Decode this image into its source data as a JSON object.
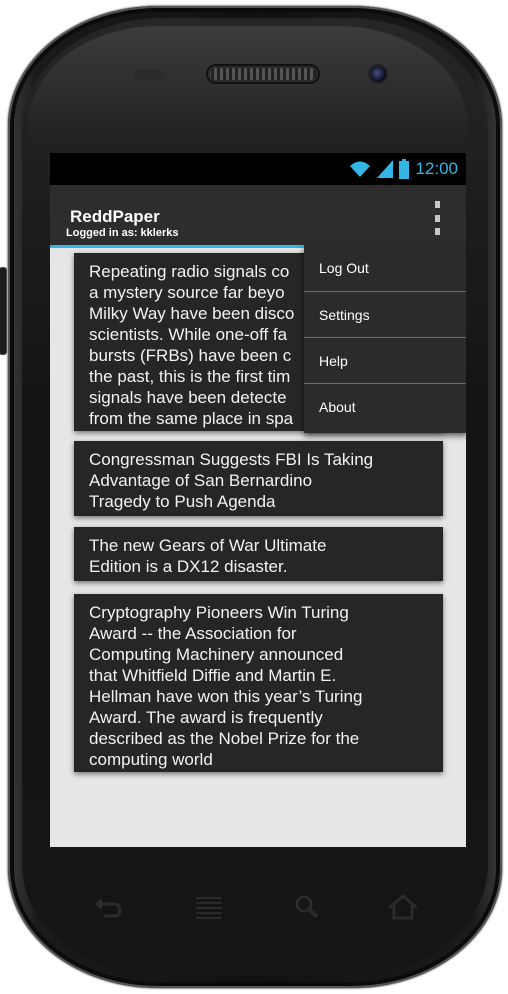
{
  "status_bar": {
    "time": "12:00",
    "icons": [
      "wifi-icon",
      "signal-icon",
      "battery-icon"
    ],
    "accent_color": "#33b5e5"
  },
  "action_bar": {
    "title": "ReddPaper",
    "subtitle": "Logged in as: kklerks",
    "overflow_icon": "more-vertical-icon"
  },
  "overflow_menu": {
    "items": [
      {
        "label": "Log Out"
      },
      {
        "label": "Settings"
      },
      {
        "label": "Help"
      },
      {
        "label": "About"
      }
    ]
  },
  "posts": [
    {
      "text": "Repeating radio signals co\na mystery source far beyo\nMilky Way have been disco\nscientists. While one-off fa\nbursts (FRBs) have been c\nthe past, this is the first tim\nsignals have been detecte\nfrom the same place in spa"
    },
    {
      "text": "Congressman Suggests FBI Is Taking\nAdvantage of San Bernardino\nTragedy to Push Agenda"
    },
    {
      "text": "The new Gears of War Ultimate\nEdition is a DX12 disaster."
    },
    {
      "text": "Cryptography Pioneers Win Turing\nAward -- the Association for\nComputing Machinery announced\nthat Whitfield Diffie and Martin E.\nHellman have won this year’s Turing\nAward. The award is frequently\ndescribed as the Nobel Prize for the\ncomputing world"
    }
  ],
  "nav_bar": {
    "icons": [
      "back-icon",
      "menu-icon",
      "search-icon",
      "home-icon"
    ]
  }
}
